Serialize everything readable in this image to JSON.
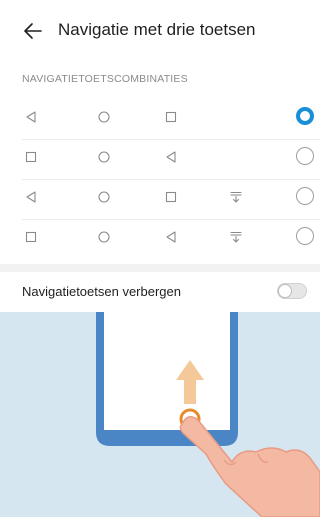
{
  "header": {
    "title": "Navigatie met drie toetsen",
    "back_icon": "arrow-left-icon"
  },
  "section": {
    "label": "NAVIGATIETOETSCOMBINATIES"
  },
  "combinations": [
    {
      "keys": [
        "back-triangle-icon",
        "home-circle-icon",
        "recent-square-icon"
      ],
      "selected": true
    },
    {
      "keys": [
        "recent-square-icon",
        "home-circle-icon",
        "back-triangle-icon"
      ],
      "selected": false
    },
    {
      "keys": [
        "back-triangle-icon",
        "home-circle-icon",
        "recent-square-icon",
        "notification-pulldown-icon"
      ],
      "selected": false
    },
    {
      "keys": [
        "recent-square-icon",
        "home-circle-icon",
        "back-triangle-icon",
        "notification-pulldown-icon"
      ],
      "selected": false
    }
  ],
  "hide_keys": {
    "label": "Navigatietoetsen verbergen",
    "enabled": false
  },
  "colors": {
    "accent": "#1a8fd8",
    "illustration_bg": "#d6e6f1",
    "phone_frame": "#4a86c5",
    "arrow": "#f5c89a",
    "finger": "#f4b9a2",
    "touch_ring": "#e98a2c"
  }
}
